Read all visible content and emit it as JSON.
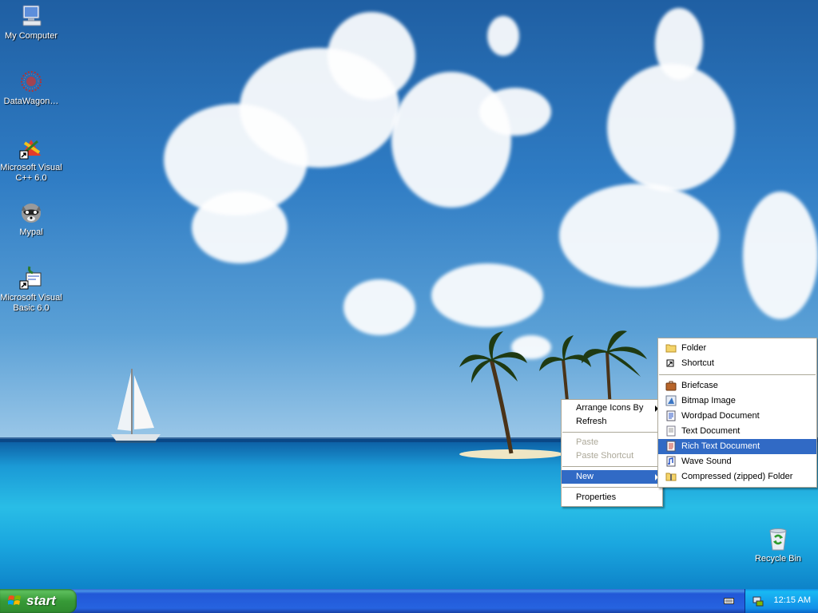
{
  "desktop": {
    "icons": [
      {
        "label": "My Computer",
        "icon": "my-computer-icon"
      },
      {
        "label": "DataWagon…",
        "icon": "datawagon-icon"
      },
      {
        "label": "Microsoft Visual C++ 6.0",
        "icon": "visual-cpp-icon"
      },
      {
        "label": "Mypal",
        "icon": "mypal-raccoon-icon"
      },
      {
        "label": "Microsoft Visual Basic 6.0",
        "icon": "visual-basic-icon"
      },
      {
        "label": "Recycle Bin",
        "icon": "recycle-bin-icon"
      }
    ]
  },
  "context_menu": {
    "items": [
      {
        "label": "Arrange Icons By",
        "submenu": true,
        "enabled": true
      },
      {
        "label": "Refresh",
        "enabled": true
      },
      {
        "label": "Paste",
        "enabled": false
      },
      {
        "label": "Paste Shortcut",
        "enabled": false
      },
      {
        "label": "New",
        "submenu": true,
        "enabled": true,
        "highlighted": true
      },
      {
        "label": "Properties",
        "enabled": true
      }
    ]
  },
  "new_submenu": {
    "items": [
      {
        "label": "Folder",
        "icon": "folder-icon"
      },
      {
        "label": "Shortcut",
        "icon": "shortcut-icon"
      },
      {
        "label": "Briefcase",
        "icon": "briefcase-icon"
      },
      {
        "label": "Bitmap Image",
        "icon": "bitmap-image-icon"
      },
      {
        "label": "Wordpad Document",
        "icon": "wordpad-document-icon"
      },
      {
        "label": "Text Document",
        "icon": "text-document-icon"
      },
      {
        "label": "Rich Text Document",
        "icon": "rich-text-document-icon",
        "highlighted": true
      },
      {
        "label": "Wave Sound",
        "icon": "wave-sound-icon"
      },
      {
        "label": "Compressed (zipped) Folder",
        "icon": "zip-folder-icon"
      }
    ]
  },
  "taskbar": {
    "start_label": "start",
    "clock": "12:15 AM"
  },
  "colors": {
    "menu_highlight": "#316ac5",
    "taskbar_blue": "#2457d9",
    "start_green": "#3c9a3c",
    "tray_blue": "#1290e8"
  }
}
